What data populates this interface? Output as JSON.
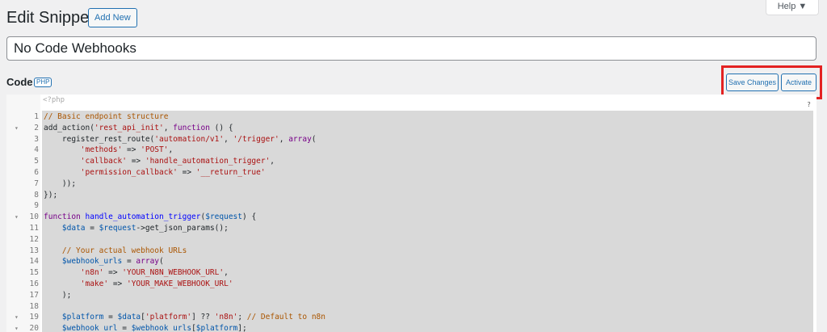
{
  "header": {
    "title": "Edit Snippet",
    "add_new_label": "Add New",
    "help_label": "Help ▼"
  },
  "snippet": {
    "title_value": "No Code Webhooks"
  },
  "code_section": {
    "label": "Code",
    "badge": "PHP",
    "save_label": "Save Changes",
    "activate_label": "Activate",
    "opener": "<?php",
    "help_mark": "?"
  },
  "editor": {
    "lines": [
      {
        "n": "1",
        "fold": false,
        "tokens": [
          [
            "comment",
            "// Basic endpoint structure"
          ]
        ]
      },
      {
        "n": "2",
        "fold": true,
        "tokens": [
          [
            "plain",
            "add_action("
          ],
          [
            "str",
            "'rest_api_init'"
          ],
          [
            "plain",
            ", "
          ],
          [
            "kw",
            "function"
          ],
          [
            "plain",
            " () {"
          ]
        ]
      },
      {
        "n": "3",
        "fold": false,
        "tokens": [
          [
            "plain",
            "    register_rest_route("
          ],
          [
            "str",
            "'automation/v1'"
          ],
          [
            "plain",
            ", "
          ],
          [
            "str",
            "'/trigger'"
          ],
          [
            "plain",
            ", "
          ],
          [
            "kw",
            "array"
          ],
          [
            "plain",
            "("
          ]
        ]
      },
      {
        "n": "4",
        "fold": false,
        "tokens": [
          [
            "plain",
            "        "
          ],
          [
            "str",
            "'methods'"
          ],
          [
            "plain",
            " => "
          ],
          [
            "str",
            "'POST'"
          ],
          [
            "plain",
            ","
          ]
        ]
      },
      {
        "n": "5",
        "fold": false,
        "tokens": [
          [
            "plain",
            "        "
          ],
          [
            "str",
            "'callback'"
          ],
          [
            "plain",
            " => "
          ],
          [
            "str",
            "'handle_automation_trigger'"
          ],
          [
            "plain",
            ","
          ]
        ]
      },
      {
        "n": "6",
        "fold": false,
        "tokens": [
          [
            "plain",
            "        "
          ],
          [
            "str",
            "'permission_callback'"
          ],
          [
            "plain",
            " => "
          ],
          [
            "str",
            "'__return_true'"
          ]
        ]
      },
      {
        "n": "7",
        "fold": false,
        "tokens": [
          [
            "plain",
            "    ));"
          ]
        ]
      },
      {
        "n": "8",
        "fold": false,
        "tokens": [
          [
            "plain",
            "});"
          ]
        ]
      },
      {
        "n": "9",
        "fold": false,
        "tokens": []
      },
      {
        "n": "10",
        "fold": true,
        "tokens": [
          [
            "kw",
            "function"
          ],
          [
            "plain",
            " "
          ],
          [
            "def",
            "handle_automation_trigger"
          ],
          [
            "plain",
            "("
          ],
          [
            "var",
            "$request"
          ],
          [
            "plain",
            ") {"
          ]
        ]
      },
      {
        "n": "11",
        "fold": false,
        "tokens": [
          [
            "plain",
            "    "
          ],
          [
            "var",
            "$data"
          ],
          [
            "plain",
            " = "
          ],
          [
            "var",
            "$request"
          ],
          [
            "plain",
            "->get_json_params();"
          ]
        ]
      },
      {
        "n": "12",
        "fold": false,
        "tokens": []
      },
      {
        "n": "13",
        "fold": false,
        "tokens": [
          [
            "plain",
            "    "
          ],
          [
            "comment",
            "// Your actual webhook URLs"
          ]
        ]
      },
      {
        "n": "14",
        "fold": false,
        "tokens": [
          [
            "plain",
            "    "
          ],
          [
            "var",
            "$webhook_urls"
          ],
          [
            "plain",
            " = "
          ],
          [
            "kw",
            "array"
          ],
          [
            "plain",
            "("
          ]
        ]
      },
      {
        "n": "15",
        "fold": false,
        "tokens": [
          [
            "plain",
            "        "
          ],
          [
            "str",
            "'n8n'"
          ],
          [
            "plain",
            " => "
          ],
          [
            "str",
            "'YOUR_N8N_WEBHOOK_URL'"
          ],
          [
            "plain",
            ","
          ]
        ]
      },
      {
        "n": "16",
        "fold": false,
        "tokens": [
          [
            "plain",
            "        "
          ],
          [
            "str",
            "'make'"
          ],
          [
            "plain",
            " => "
          ],
          [
            "str",
            "'YOUR_MAKE_WEBHOOK_URL'"
          ]
        ]
      },
      {
        "n": "17",
        "fold": false,
        "tokens": [
          [
            "plain",
            "    );"
          ]
        ]
      },
      {
        "n": "18",
        "fold": false,
        "tokens": []
      },
      {
        "n": "19",
        "fold": true,
        "tokens": [
          [
            "plain",
            "    "
          ],
          [
            "var",
            "$platform"
          ],
          [
            "plain",
            " = "
          ],
          [
            "var",
            "$data"
          ],
          [
            "plain",
            "["
          ],
          [
            "str",
            "'platform'"
          ],
          [
            "plain",
            "] ?? "
          ],
          [
            "str",
            "'n8n'"
          ],
          [
            "plain",
            "; "
          ],
          [
            "comment",
            "// Default to n8n"
          ]
        ]
      },
      {
        "n": "20",
        "fold": true,
        "tokens": [
          [
            "plain",
            "    "
          ],
          [
            "var",
            "$webhook_url"
          ],
          [
            "plain",
            " = "
          ],
          [
            "var",
            "$webhook_urls"
          ],
          [
            "plain",
            "["
          ],
          [
            "var",
            "$platform"
          ],
          [
            "plain",
            "];"
          ]
        ]
      }
    ]
  }
}
